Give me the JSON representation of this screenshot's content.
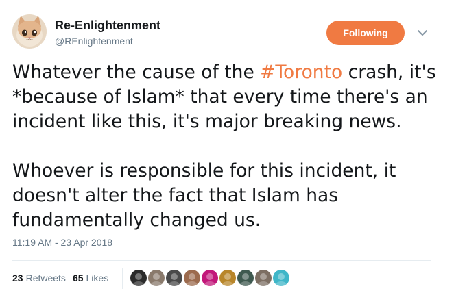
{
  "user": {
    "display_name": "Re-Enlightenment",
    "screen_name": "@REnlightenment",
    "avatar_icon": "kitten-avatar-icon"
  },
  "follow_button": {
    "label": "Following"
  },
  "tweet": {
    "para1_before": "Whatever the cause of the ",
    "hashtag": "#Toronto",
    "para1_after": " crash, it's *because of Islam* that every time there's an incident like this, it's major breaking news.",
    "para2": "Whoever is responsible for this incident, it doesn't alter the fact that Islam has fundamentally changed us."
  },
  "timestamp": "11:19 AM - 23 Apr 2018",
  "stats": {
    "retweets_count": "23",
    "retweets_label": "Retweets",
    "likes_count": "65",
    "likes_label": "Likes"
  },
  "likers": [
    {
      "name": "liker-avatar-1",
      "color": "#2b2b2b"
    },
    {
      "name": "liker-avatar-2",
      "color": "#8a7a6c"
    },
    {
      "name": "liker-avatar-3",
      "color": "#4a4a4a"
    },
    {
      "name": "liker-avatar-4",
      "color": "#9c6b4e"
    },
    {
      "name": "liker-avatar-5",
      "color": "#c2187a"
    },
    {
      "name": "liker-avatar-6",
      "color": "#b8862a"
    },
    {
      "name": "liker-avatar-7",
      "color": "#3f5a50"
    },
    {
      "name": "liker-avatar-8",
      "color": "#7d6f63"
    },
    {
      "name": "liker-avatar-9",
      "color": "#3fb6c8"
    }
  ],
  "colors": {
    "accent": "#f07a42",
    "text": "#14171a",
    "secondary": "#657786",
    "divider": "#e6ecf0"
  }
}
